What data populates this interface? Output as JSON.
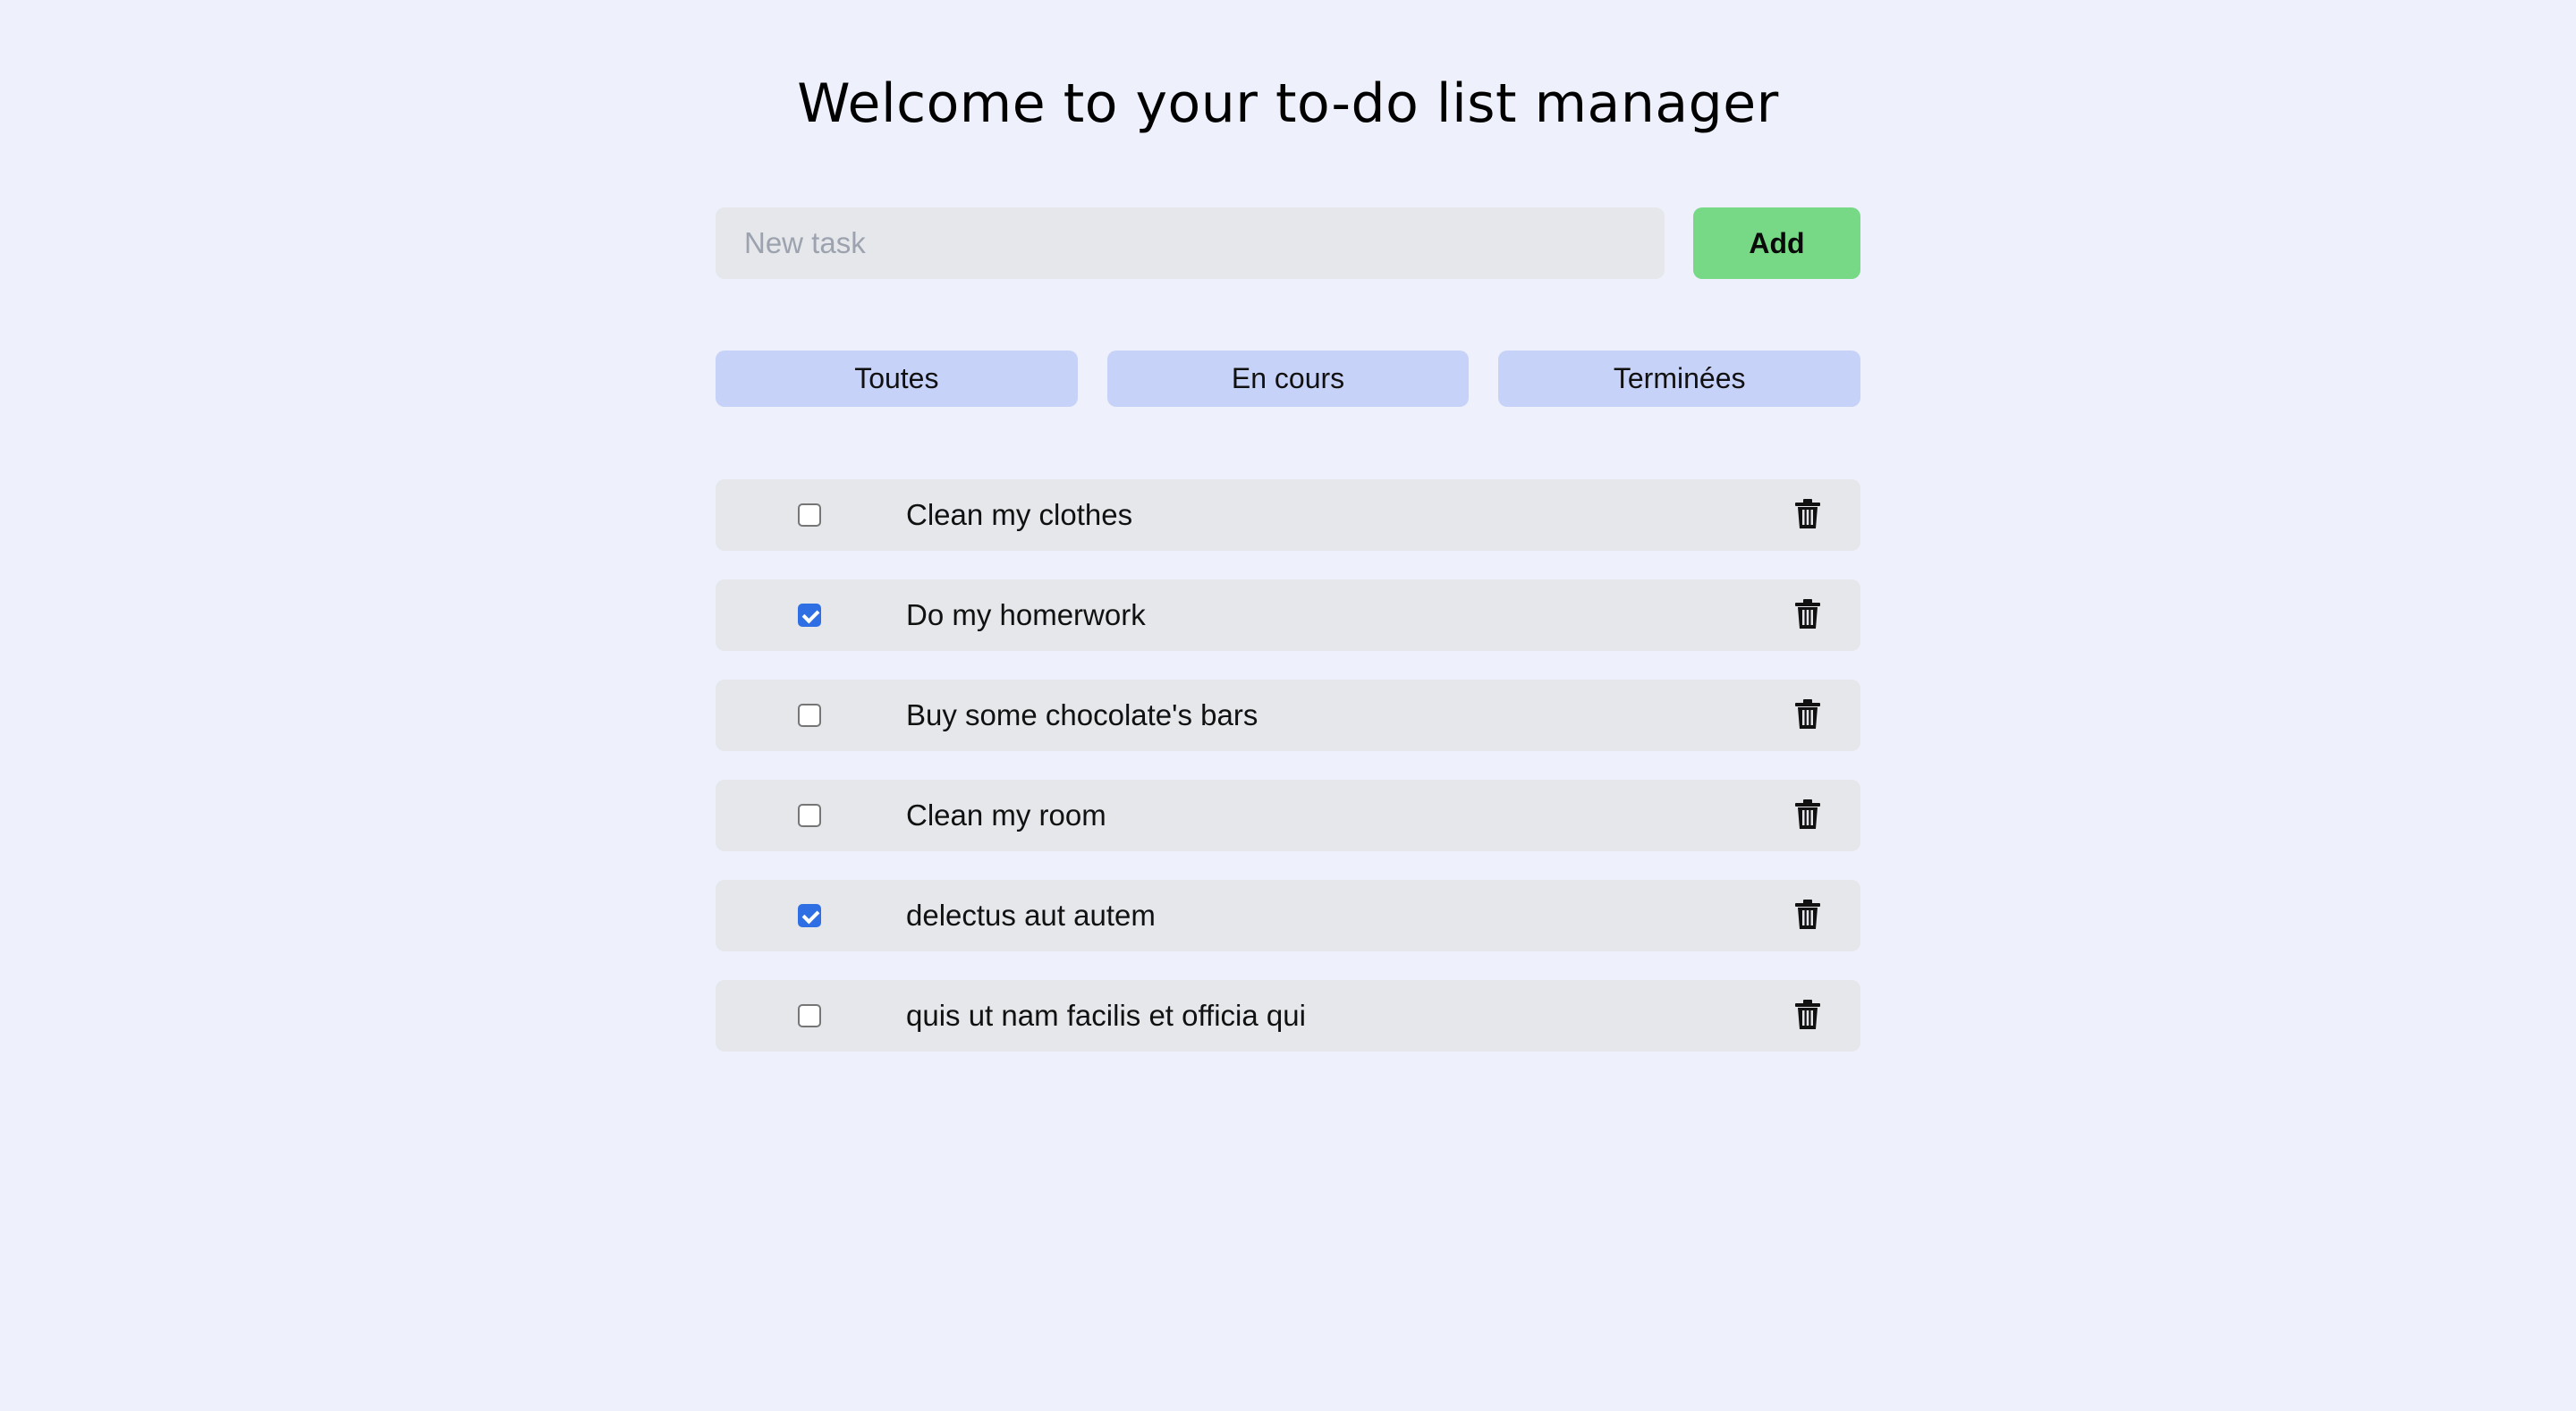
{
  "header": {
    "title": "Welcome to your to-do list manager"
  },
  "new_task": {
    "placeholder": "New task",
    "value": "",
    "add_label": "Add"
  },
  "filters": [
    {
      "label": "Toutes"
    },
    {
      "label": "En cours"
    },
    {
      "label": "Terminées"
    }
  ],
  "tasks": [
    {
      "label": "Clean my clothes",
      "checked": false
    },
    {
      "label": "Do my homerwork",
      "checked": true
    },
    {
      "label": "Buy some chocolate's bars",
      "checked": false
    },
    {
      "label": "Clean my room",
      "checked": false
    },
    {
      "label": "delectus aut autem",
      "checked": true
    },
    {
      "label": "quis ut nam facilis et officia qui",
      "checked": false
    }
  ],
  "icons": {
    "delete": "trash-icon",
    "checkbox_checked": "checkmark-icon"
  },
  "colors": {
    "background": "#eef1fc",
    "add_button": "#77d886",
    "filter_button": "#c7d2f8",
    "task_row": "#e5e7eb",
    "checkbox_checked": "#2f6fe4"
  }
}
